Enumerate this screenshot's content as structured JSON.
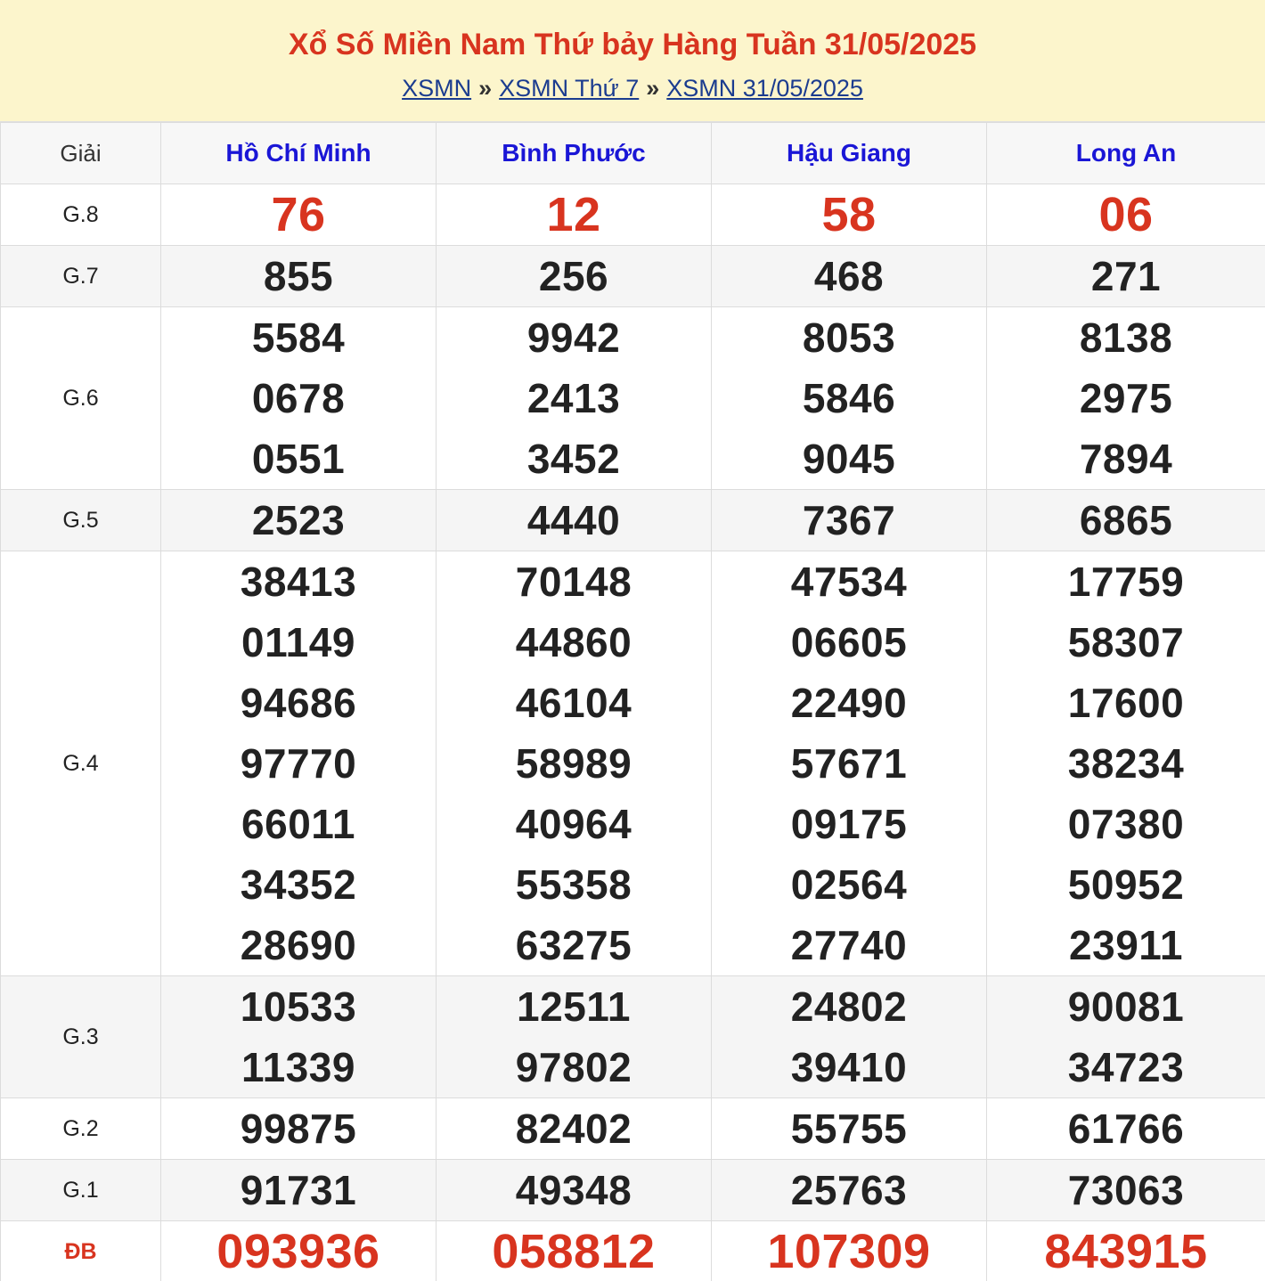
{
  "header": {
    "title": "Xổ Số Miền Nam Thứ bảy Hàng Tuần 31/05/2025",
    "crumbs": [
      "XSMN",
      "XSMN Thứ 7",
      "XSMN 31/05/2025"
    ],
    "separator": "»"
  },
  "table": {
    "prize_header": "Giải",
    "provinces": [
      "Hồ Chí Minh",
      "Bình Phước",
      "Hậu Giang",
      "Long An"
    ],
    "rows": [
      {
        "label": "G.8",
        "values": [
          [
            "76"
          ],
          [
            "12"
          ],
          [
            "58"
          ],
          [
            "06"
          ]
        ]
      },
      {
        "label": "G.7",
        "values": [
          [
            "855"
          ],
          [
            "256"
          ],
          [
            "468"
          ],
          [
            "271"
          ]
        ]
      },
      {
        "label": "G.6",
        "values": [
          [
            "5584",
            "0678",
            "0551"
          ],
          [
            "9942",
            "2413",
            "3452"
          ],
          [
            "8053",
            "5846",
            "9045"
          ],
          [
            "8138",
            "2975",
            "7894"
          ]
        ]
      },
      {
        "label": "G.5",
        "values": [
          [
            "2523"
          ],
          [
            "4440"
          ],
          [
            "7367"
          ],
          [
            "6865"
          ]
        ]
      },
      {
        "label": "G.4",
        "values": [
          [
            "38413",
            "01149",
            "94686",
            "97770",
            "66011",
            "34352",
            "28690"
          ],
          [
            "70148",
            "44860",
            "46104",
            "58989",
            "40964",
            "55358",
            "63275"
          ],
          [
            "47534",
            "06605",
            "22490",
            "57671",
            "09175",
            "02564",
            "27740"
          ],
          [
            "17759",
            "58307",
            "17600",
            "38234",
            "07380",
            "50952",
            "23911"
          ]
        ]
      },
      {
        "label": "G.3",
        "values": [
          [
            "10533",
            "11339"
          ],
          [
            "12511",
            "97802"
          ],
          [
            "24802",
            "39410"
          ],
          [
            "90081",
            "34723"
          ]
        ]
      },
      {
        "label": "G.2",
        "values": [
          [
            "99875"
          ],
          [
            "82402"
          ],
          [
            "55755"
          ],
          [
            "61766"
          ]
        ]
      },
      {
        "label": "G.1",
        "values": [
          [
            "91731"
          ],
          [
            "49348"
          ],
          [
            "25763"
          ],
          [
            "73063"
          ]
        ]
      },
      {
        "label": "ĐB",
        "values": [
          [
            "093936"
          ],
          [
            "058812"
          ],
          [
            "107309"
          ],
          [
            "843915"
          ]
        ]
      }
    ]
  }
}
